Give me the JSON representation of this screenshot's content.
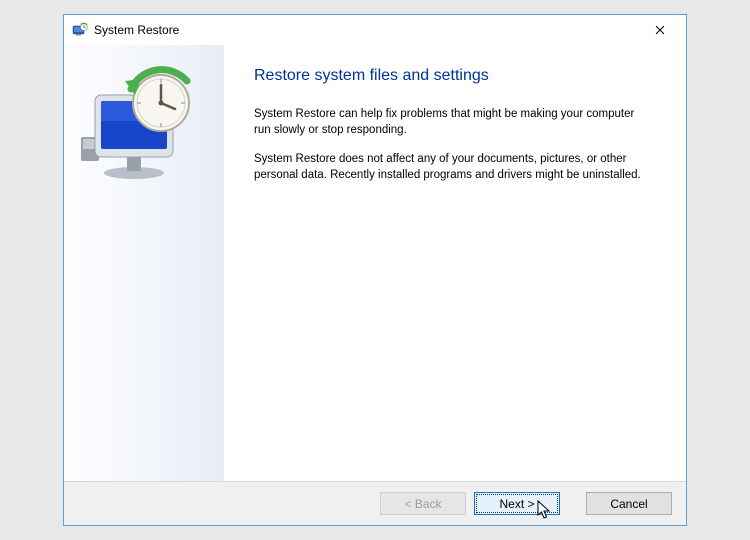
{
  "window": {
    "title": "System Restore"
  },
  "main": {
    "heading": "Restore system files and settings",
    "paragraph1": "System Restore can help fix problems that might be making your computer run slowly or stop responding.",
    "paragraph2": "System Restore does not affect any of your documents, pictures, or other personal data. Recently installed programs and drivers might be uninstalled."
  },
  "buttons": {
    "back": "< Back",
    "next": "Next >",
    "cancel": "Cancel"
  }
}
